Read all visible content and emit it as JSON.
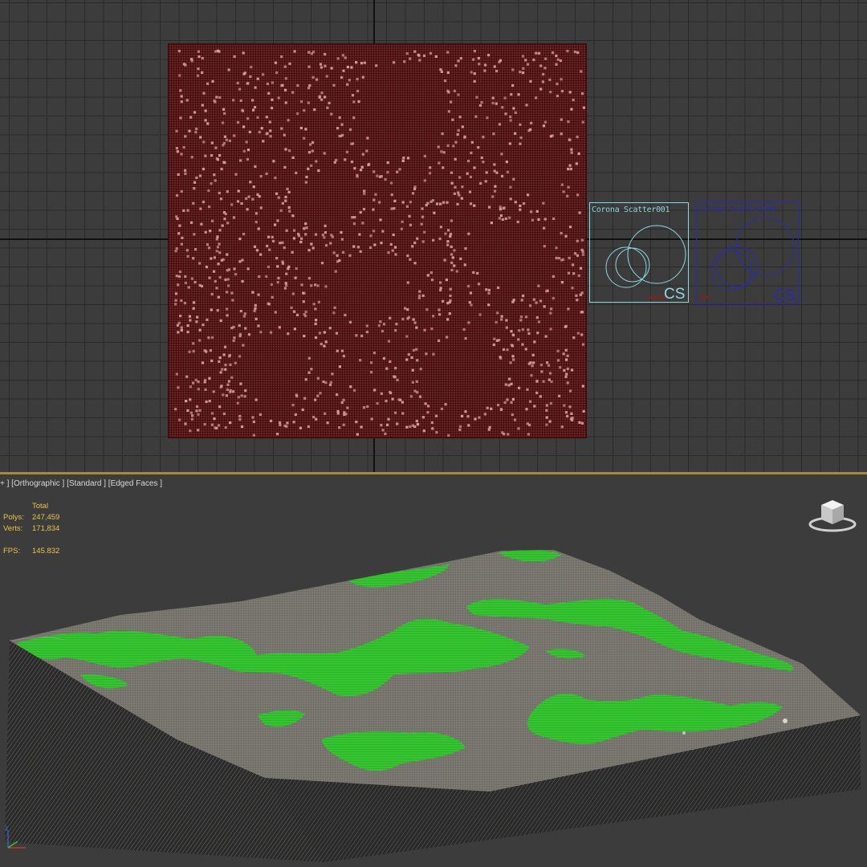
{
  "top_viewport": {
    "objects": [
      {
        "label": "Corona  Scatter001",
        "color": "#8fd6e0",
        "badge": "CS"
      },
      {
        "label": "Corona  Scatter002",
        "color": "#2a2ab6",
        "badge": "CS"
      }
    ],
    "colors": {
      "plane": "#6b2222",
      "dots": "#d99c9c"
    }
  },
  "bottom_viewport": {
    "label": "+ ] [Orthographic ] [Standard ] [Edged Faces ]",
    "stats": {
      "header": "Total",
      "polys_label": "Polys:",
      "polys_value": "247,459",
      "verts_label": "Verts:",
      "verts_value": "171,834",
      "fps_label": "FPS:",
      "fps_value": "145.832"
    },
    "colors": {
      "terrain": "#7e7a74",
      "grass": "#33c02e",
      "stat_text": "#e8c44a"
    },
    "icons": {
      "viewcube": "viewcube-icon",
      "axis": "axis-tripod-icon"
    }
  }
}
